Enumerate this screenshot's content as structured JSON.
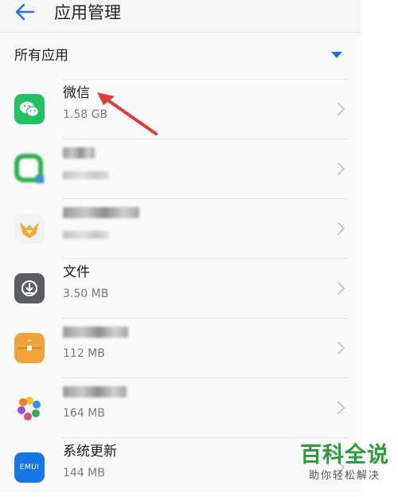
{
  "header": {
    "title": "应用管理",
    "back_icon": "arrow-left-icon"
  },
  "filter": {
    "label": "所有应用",
    "dropdown_icon": "caret-down-icon",
    "accent": "#1a73e8"
  },
  "apps": [
    {
      "name": "微信",
      "size": "1.58 GB",
      "icon": "wechat-icon",
      "color": "#20c160"
    },
    {
      "name": "",
      "size": "",
      "icon": "blurred-app-icon",
      "color": "#2fb24a"
    },
    {
      "name": "",
      "size": "",
      "icon": "fox-app-icon",
      "color": "#f3a72c"
    },
    {
      "name": "文件",
      "size": "3.50 MB",
      "icon": "files-icon",
      "color": "#5a5e64"
    },
    {
      "name": "",
      "size": "112 MB",
      "icon": "briefcase-icon",
      "color": "#f2a23a"
    },
    {
      "name": "",
      "size": "164 MB",
      "icon": "flower-app-icon",
      "color": "#e24a8a"
    },
    {
      "name": "系统更新",
      "size": "144 MB",
      "icon": "emui-icon",
      "icon_text": "EMUI",
      "color": "#1577e6"
    }
  ],
  "annotation": {
    "icon": "red-arrow-annotation",
    "color": "#e23a3a"
  },
  "watermark": {
    "title": "百科全说",
    "subtitle": "助你轻松解决",
    "color": "#2a9d38"
  }
}
